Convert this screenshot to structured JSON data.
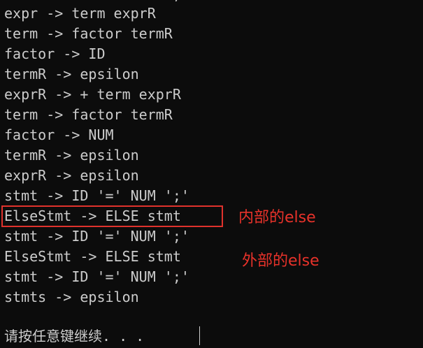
{
  "console": {
    "lines": [
      "expr -> term exprR",
      "term -> factor termR",
      "factor -> ID",
      "termR -> epsilon",
      "exprR -> + term exprR",
      "term -> factor termR",
      "factor -> NUM",
      "termR -> epsilon",
      "exprR -> epsilon",
      "stmt -> ID '=' NUM ';'",
      "ElseStmt -> ELSE stmt",
      "stmt -> ID '=' NUM ';'",
      "ElseStmt -> ELSE stmt",
      "stmt -> ID '=' NUM ';'",
      "stmts -> epsilon"
    ],
    "prompt": "请按任意键继续. . ."
  },
  "annotations": {
    "inner_else": "内部的else",
    "outer_else": "外部的else",
    "color": "#e8322a"
  },
  "colors": {
    "background": "#0c0c0c",
    "text": "#cccccc"
  }
}
